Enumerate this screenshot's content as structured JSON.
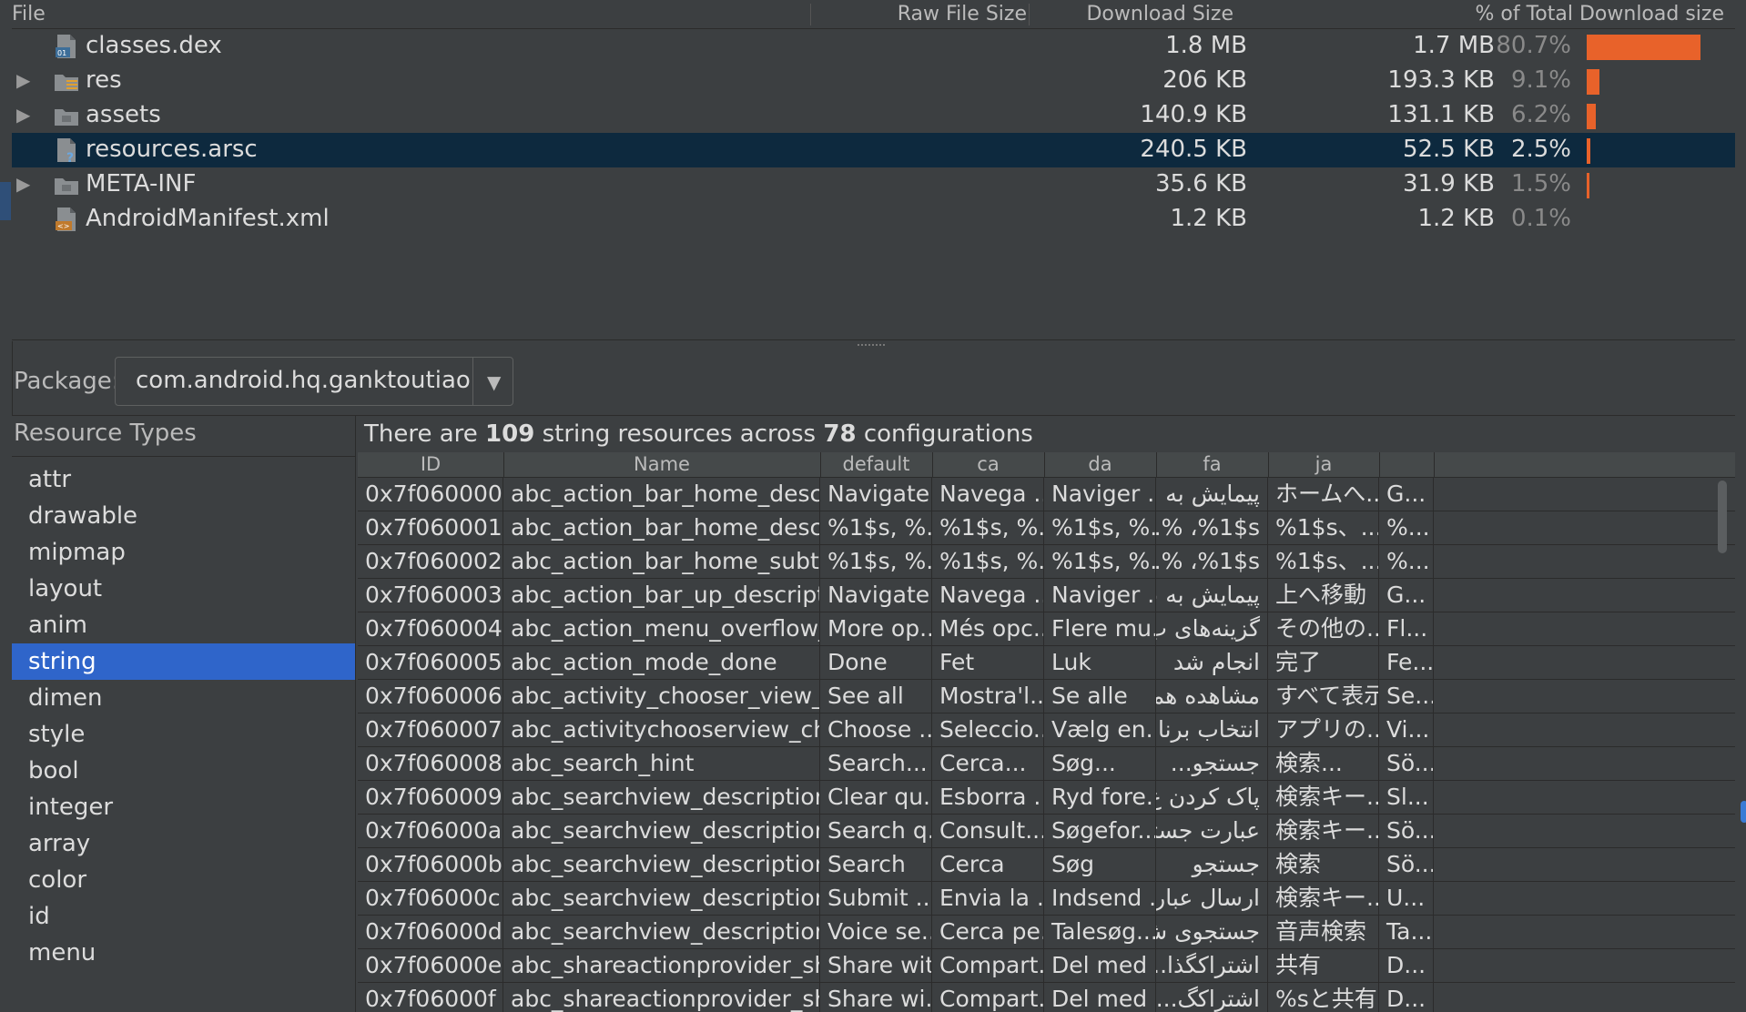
{
  "tree": {
    "headers": {
      "file": "File",
      "raw": "Raw File Size",
      "download": "Download Size",
      "pct": "% of Total Download size"
    },
    "rows": [
      {
        "name": "classes.dex",
        "raw": "1.8 MB",
        "download": "1.7 MB",
        "pct": "80.7%",
        "percent_value": 80.7,
        "expandable": false,
        "icon": "dex-file-icon",
        "selected": false
      },
      {
        "name": "res",
        "raw": "206 KB",
        "download": "193.3 KB",
        "pct": "9.1%",
        "percent_value": 9.1,
        "expandable": true,
        "icon": "res-folder-icon",
        "selected": false
      },
      {
        "name": "assets",
        "raw": "140.9 KB",
        "download": "131.1 KB",
        "pct": "6.2%",
        "percent_value": 6.2,
        "expandable": true,
        "icon": "folder-icon",
        "selected": false
      },
      {
        "name": "resources.arsc",
        "raw": "240.5 KB",
        "download": "52.5 KB",
        "pct": "2.5%",
        "percent_value": 2.5,
        "expandable": false,
        "icon": "unknown-file-icon",
        "selected": true
      },
      {
        "name": "META-INF",
        "raw": "35.6 KB",
        "download": "31.9 KB",
        "pct": "1.5%",
        "percent_value": 1.5,
        "expandable": true,
        "icon": "folder-icon",
        "selected": false
      },
      {
        "name": "AndroidManifest.xml",
        "raw": "1.2 KB",
        "download": "1.2 KB",
        "pct": "0.1%",
        "percent_value": 0.1,
        "expandable": false,
        "icon": "xml-file-icon",
        "selected": false
      }
    ],
    "bar_color": "#e8622a",
    "expander_glyph": "▶"
  },
  "package": {
    "label": "Package:",
    "value": "com.android.hq.ganktoutiao",
    "arrow": "▼"
  },
  "resource_types": {
    "title": "Resource Types",
    "items": [
      "attr",
      "drawable",
      "mipmap",
      "layout",
      "anim",
      "string",
      "dimen",
      "style",
      "bool",
      "integer",
      "array",
      "color",
      "id",
      "menu"
    ],
    "selected": "string",
    "selected_color": "#2f65ca"
  },
  "summary": {
    "prefix": "There are ",
    "count": "109",
    "middle": " string resources across ",
    "configs": "78",
    "suffix": " configurations"
  },
  "table": {
    "columns": [
      "ID",
      "Name",
      "default",
      "ca",
      "da",
      "fa",
      "ja",
      ""
    ],
    "rows": [
      [
        "0x7f060000",
        "abc_action_bar_home_description",
        "Navigate...",
        "Navega ...",
        "Naviger ...",
        "پیمایش به ...",
        "ホームへ...",
        "G..."
      ],
      [
        "0x7f060001",
        "abc_action_bar_home_description_fo...",
        "%1$s, %...",
        "%1$s, %...",
        "%1$s, %...",
        "%1$s، %...",
        "%1$s、...",
        "%..."
      ],
      [
        "0x7f060002",
        "abc_action_bar_home_subtitle_descri...",
        "%1$s, %...",
        "%1$s, %...",
        "%1$s, %...",
        "%1$s، %...",
        "%1$s、...",
        "%..."
      ],
      [
        "0x7f060003",
        "abc_action_bar_up_description",
        "Navigate...",
        "Navega ...",
        "Naviger ...",
        "پیمایش به بالا",
        "上へ移動",
        "G..."
      ],
      [
        "0x7f060004",
        "abc_action_menu_overflow_description",
        "More op...",
        "Més opc...",
        "Flere mu...",
        "گزینه‌های ب...",
        "その他の...",
        "Fl..."
      ],
      [
        "0x7f060005",
        "abc_action_mode_done",
        "Done",
        "Fet",
        "Luk",
        "انجام شد",
        "完了",
        "Fe..."
      ],
      [
        "0x7f060006",
        "abc_activity_chooser_view_see_all",
        "See all",
        "Mostra'l...",
        "Se alle",
        "مشاهده همه",
        "すべて表示",
        "Se..."
      ],
      [
        "0x7f060007",
        "abc_activitychooserview_choose_app...",
        "Choose ...",
        "Seleccio...",
        "Vælg en...",
        "انتخاب برنامه",
        "アプリの...",
        "Vi..."
      ],
      [
        "0x7f060008",
        "abc_search_hint",
        "Search...",
        "Cerca...",
        "Søg...",
        "جستجو...",
        "検索...",
        "Sö..."
      ],
      [
        "0x7f060009",
        "abc_searchview_description_clear",
        "Clear qu...",
        "Esborra ...",
        "Ryd fore...",
        "پاک کردن ع...",
        "検索キー...",
        "Sl..."
      ],
      [
        "0x7f06000a",
        "abc_searchview_description_query",
        "Search q...",
        "Consult...",
        "Søgefor...",
        "عبارت جستجو",
        "検索キー...",
        "Sö..."
      ],
      [
        "0x7f06000b",
        "abc_searchview_description_search",
        "Search",
        "Cerca",
        "Søg",
        "جستجو",
        "検索",
        "Sö..."
      ],
      [
        "0x7f06000c",
        "abc_searchview_description_submit",
        "Submit ...",
        "Envia la ...",
        "Indsend ...",
        "ارسال عبار...",
        "検索キー...",
        "U..."
      ],
      [
        "0x7f06000d",
        "abc_searchview_description_voice",
        "Voice se...",
        "Cerca pe...",
        "Talesøg...",
        "جستجوی ش...",
        "音声検索",
        "Ta..."
      ],
      [
        "0x7f06000e",
        "abc_shareactionprovider_share_with",
        "Share with",
        "Compart...",
        "Del med",
        "اشتراکگذا...",
        "共有",
        "D..."
      ],
      [
        "0x7f06000f",
        "abc_shareactionprovider_share_with_...",
        "Share wi...",
        "Compart...",
        "Del med ...",
        "اشتراکگ...",
        "%sと共有",
        "D..."
      ]
    ]
  }
}
